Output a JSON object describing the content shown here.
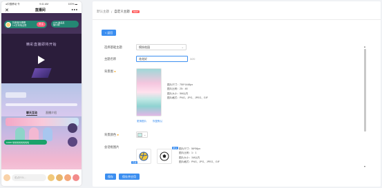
{
  "colors": {
    "primary": "#3b8ef0",
    "follow": "#ff5c7a",
    "required": "#f5a623",
    "new_tag": "#ff5c5c",
    "bg_color_swatch": "#c6efe8"
  },
  "phone": {
    "status_left": "●中国移动 令",
    "status_center": "9:41 AM",
    "status_right": "100% ▬",
    "close_icon": "close-icon",
    "title": "直播间",
    "more_icon": "more-icon",
    "host_text_1": "抖音音乐嗯嗯",
    "host_text_2": "1.4万本场点赞",
    "follow_label": "关注",
    "live_rank_1": "LIVE 精品直",
    "live_rank_2": "播12期",
    "video_text": "精彩直播即将开始",
    "tab_1": "聊天互动",
    "tab_2": "直播介绍",
    "chat_message": "10087 哈哈哈哈哈哈哈哈",
    "input_placeholder": "说点什么…"
  },
  "breadcrumb": {
    "parent": "默认主题",
    "separator": "/",
    "current": "自定义主题",
    "tag": "NEW"
  },
  "form": {
    "back_label": "< 返回",
    "theme_label": "选择基础主题",
    "theme_value": "缤纷花园",
    "name_label": "主题名称",
    "name_value": "花花好",
    "name_counter": "3/20",
    "bg_label": "背景图",
    "bg_info_1": "图片尺寸：750*1448px",
    "bg_info_2": "图片比例：25：48",
    "bg_info_3": "图片大小：5M以内",
    "bg_info_4": "图片格式：PNG、JPG、JPEG、GIF",
    "bg_change": "更换图片",
    "bg_restore": "恢复默认",
    "color_label": "背景颜色",
    "chat_label": "会话框图片",
    "chat_badge_1": "已选",
    "chat_badge_2": "默认",
    "chat_info_1": "图片尺寸：56*56px",
    "chat_info_2": "图片比例：1：1",
    "chat_info_3": "图片大小：1M以内",
    "chat_info_4": "图片格式：PNG、JPG、JPEG、GIF",
    "save_label": "保存",
    "apply_label": "保存并应用"
  }
}
